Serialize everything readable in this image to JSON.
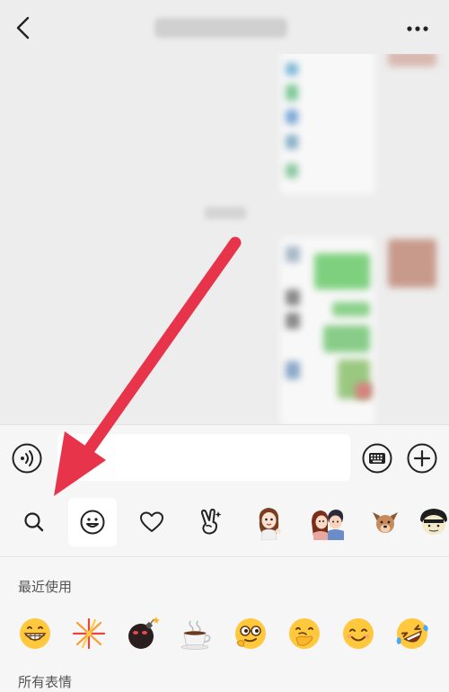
{
  "header": {
    "back_icon": "chevron-left-icon",
    "more_icon": "ellipsis-icon"
  },
  "input_bar": {
    "voice_icon": "voice-icon",
    "keyboard_icon": "keyboard-icon",
    "plus_icon": "plus-icon"
  },
  "emoji_tabs": [
    {
      "icon": "search-icon"
    },
    {
      "icon": "smiley-icon",
      "active": true
    },
    {
      "icon": "heart-icon"
    },
    {
      "icon": "victory-hand-icon"
    },
    {
      "icon": "sticker-girl-icon"
    },
    {
      "icon": "sticker-couple-icon"
    },
    {
      "icon": "sticker-dog-icon"
    },
    {
      "icon": "sticker-man-icon"
    }
  ],
  "panel": {
    "recent_label": "最近使用",
    "all_label": "所有表情",
    "recent_emojis": [
      "😁",
      "🎆",
      "💣",
      "☕",
      "🤓",
      "🤭",
      "😊",
      "😂"
    ]
  },
  "colors": {
    "arrow": "#e8344a",
    "background": "#ededed",
    "panel": "#f6f6f6"
  }
}
